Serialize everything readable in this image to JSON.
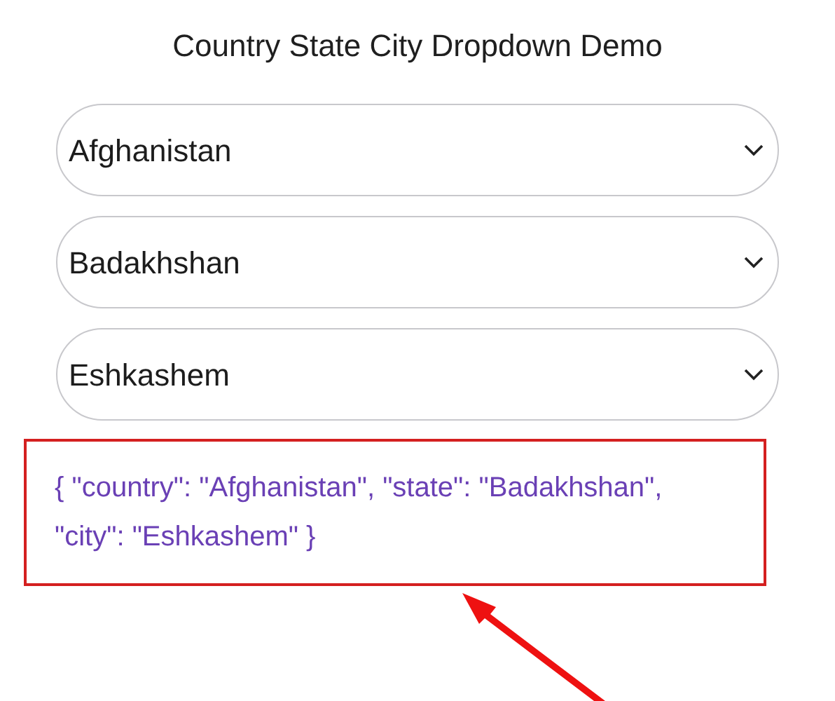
{
  "title": "Country State City Dropdown Demo",
  "dropdowns": [
    {
      "value": "Afghanistan"
    },
    {
      "value": "Badakhshan"
    },
    {
      "value": "Eshkashem"
    }
  ],
  "output": "{ \"country\": \"Afghanistan\", \"state\": \"Badakhshan\", \"city\": \"Eshkashem\" }"
}
